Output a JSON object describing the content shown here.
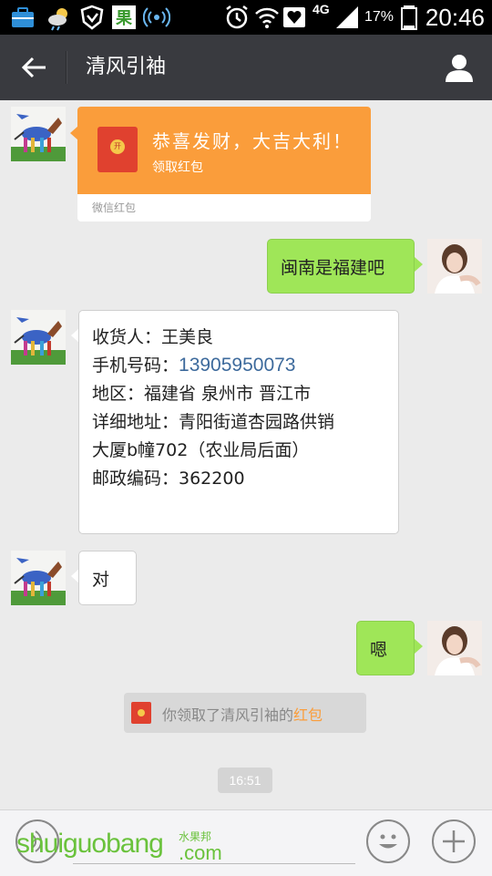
{
  "status_bar": {
    "network": "4G",
    "battery": "17%",
    "time": "20:46",
    "icons": [
      "toolbox-icon",
      "weather-icon",
      "shield-icon",
      "app-icon",
      "nfc-icon",
      "alarm-icon",
      "wifi-icon",
      "heart-icon",
      "signal-icon",
      "battery-icon"
    ]
  },
  "nav": {
    "title": "清风引袖",
    "back_icon": "arrow-left-icon",
    "profile_icon": "person-icon"
  },
  "messages": {
    "red_packet": {
      "title": "恭喜发财，大吉大利！",
      "action": "领取红包",
      "footer": "微信红包",
      "seal_char": "开"
    },
    "msg1": "闽南是福建吧",
    "address": {
      "line1": "收货人：王美良",
      "line2_label": "手机号码：",
      "line2_phone": "13905950073",
      "line3": "地区：福建省 泉州市 晋江市",
      "line4": "详细地址：青阳街道杏园路供销",
      "line5": "大厦b幢702（农业局后面）",
      "line6": "邮政编码：362200"
    },
    "msg2": "对",
    "msg3": "嗯",
    "notice": {
      "text": "你领取了清风引袖的",
      "link": "红包"
    },
    "time": "16:51"
  },
  "input_bar": {
    "watermark": "shuiguobang",
    "watermark_cn": "水果邦",
    "watermark_com": ".com"
  },
  "colors": {
    "nav_bg": "#393a3f",
    "chat_bg": "#ebebeb",
    "bubble_green": "#9fe658",
    "packet_orange": "#fa9d3b",
    "packet_red": "#e0412f",
    "phone_link": "#3d6a9c"
  }
}
